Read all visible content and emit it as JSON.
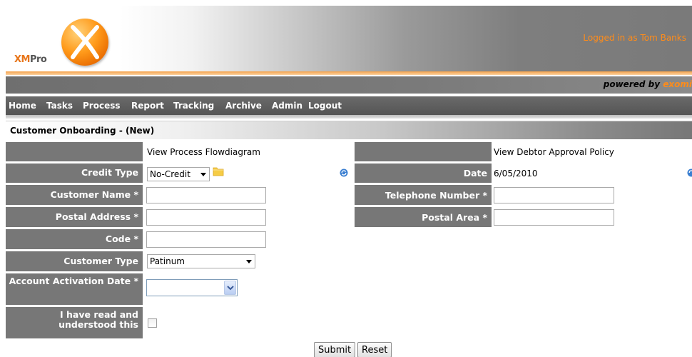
{
  "header": {
    "logo_text_xm": "XM",
    "logo_text_pro": "Pro",
    "logged_in": "Logged in as Tom Banks",
    "powered_by": "powered by",
    "powered_brand": "exomi"
  },
  "nav": {
    "items": [
      "Home",
      "Tasks",
      "Process",
      "Report",
      "Tracking",
      "Archive",
      "Admin",
      "Logout"
    ]
  },
  "page": {
    "title": "Customer Onboarding - (New)"
  },
  "form": {
    "flow_link": "View Process Flowdiagram",
    "policy_link": "View Debtor Approval Policy",
    "credit_type_label": "Credit Type",
    "credit_type_value": "No-Credit",
    "date_label": "Date",
    "date_value": "6/05/2010",
    "customer_name_label": "Customer Name *",
    "telephone_label": "Telephone Number *",
    "postal_address_label": "Postal Address *",
    "postal_area_label": "Postal Area *",
    "code_label": "Code *",
    "customer_type_label": "Customer Type",
    "customer_type_value": "Patinum",
    "activation_label": "Account Activation Date *",
    "agree_label": "I have read and understood this",
    "agree_checked": false
  },
  "buttons": {
    "submit": "Submit",
    "reset": "Reset"
  },
  "colors": {
    "accent": "#ff8c1a",
    "label_bg": "#777777"
  }
}
